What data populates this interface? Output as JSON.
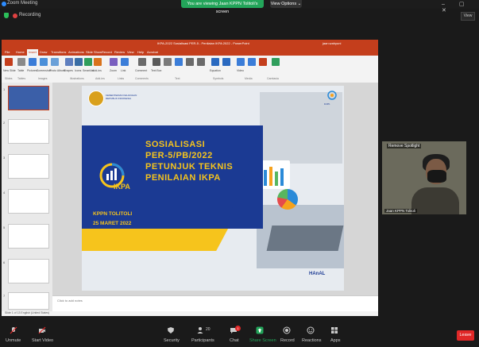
{
  "window": {
    "title": "Zoom Meeting",
    "controls": "– ▢ ✕"
  },
  "share_banner": {
    "text": "You are viewing Jaan    KPPN Tolitoli's screen",
    "view_options": "View Options ⌄"
  },
  "recording": {
    "label": "Recording"
  },
  "view_button": {
    "label": "View"
  },
  "ppt": {
    "doc_title": "IKPA-2022 Sosialisasi PER-5 - Penilaian IKPA 2022 - PowerPoint",
    "user": "jaan.wahyuni",
    "tabs": [
      "File",
      "Home",
      "Insert",
      "Draw",
      "Transitions",
      "Animations",
      "Slide Show",
      "Record",
      "Review",
      "View",
      "Help",
      "Acrobat"
    ],
    "ribbon_buttons": [
      "New Slide",
      "Table",
      "Pictures",
      "Screenshot",
      "Photo Album",
      "Shapes",
      "Icons",
      "3D",
      "SmartArt",
      "Chart",
      "Add-ins",
      "Zoom",
      "Link",
      "Action",
      "Comment",
      "Text Box",
      "Header & Footer",
      "WordArt",
      "Date & Time",
      "Slide Number",
      "Object",
      "Equation",
      "Symbol",
      "Video",
      "Audio",
      "Screen Recording",
      "Insert Media"
    ],
    "ribbon_groups": [
      "Slides",
      "Tables",
      "Images",
      "Illustrations",
      "Add-ins",
      "Links",
      "Comments",
      "Text",
      "Symbols",
      "Media",
      "Camtasia"
    ],
    "thumbnails": [
      "1",
      "2",
      "3",
      "4",
      "5",
      "6",
      "7"
    ],
    "notes_placeholder": "Click to add notes",
    "status": "Slide 1 of 13   English (United States)"
  },
  "slide": {
    "org": "KEMENTERIAN KEUANGAN REPUBLIK INDONESIA",
    "logo_text": "IKPA",
    "title_lines": [
      "SOSIALISASI",
      "PER-5/PB/2022",
      "PETUNJUK TEKNIS",
      "PENILAIAN IKPA"
    ],
    "office": "KPPN TOLITOLI",
    "date": "25 MARET 2022",
    "footer_brand": "HAnAL",
    "corner_brand": "DJPb"
  },
  "video": {
    "label": "Remove Spotlight",
    "name": "Jaan    KPPN Tolitoli"
  },
  "toolbar": {
    "unmute": "Unmute",
    "start_video": "Start Video",
    "security": "Security",
    "participants": "Participants",
    "participants_count": "20",
    "chat": "Chat",
    "chat_badge": "1",
    "share_screen": "Share Screen",
    "record": "Record",
    "reactions": "Reactions",
    "apps": "Apps",
    "leave": "Leave"
  },
  "colors": {
    "ppt_accent": "#c43e1c",
    "slide_blue": "#1b3a93",
    "slide_yellow": "#f6c41c",
    "zoom_green": "#23a55a",
    "leave_red": "#e02828"
  }
}
